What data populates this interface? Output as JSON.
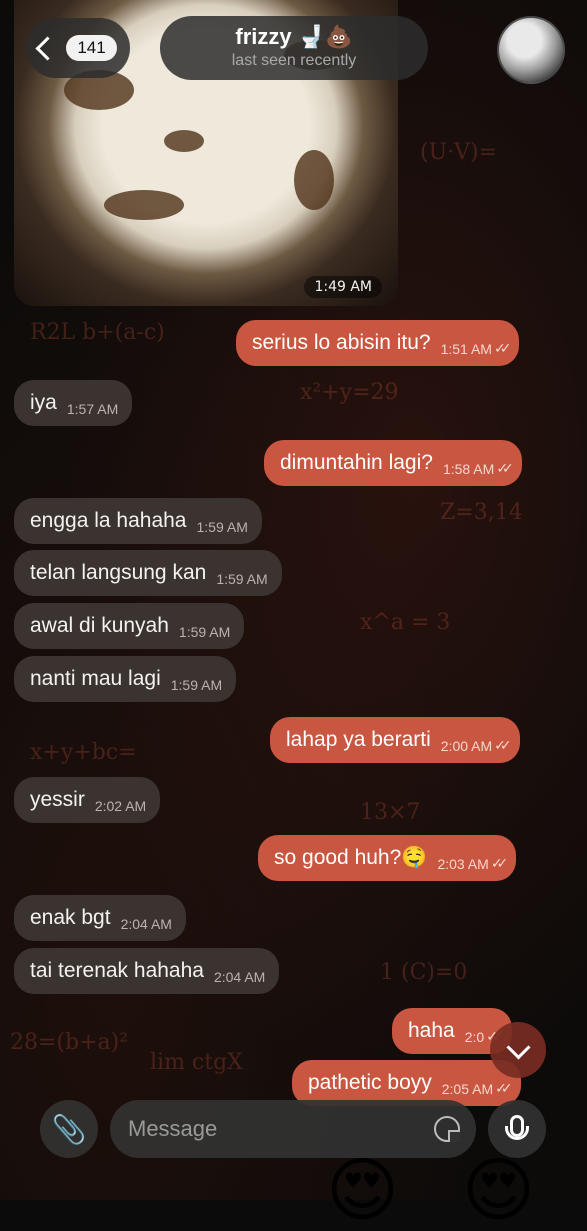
{
  "header": {
    "unread_count": "141",
    "contact_name": "frizzy 🚽💩",
    "status": "last seen recently"
  },
  "image_message": {
    "time": "1:49 AM"
  },
  "messages": [
    {
      "dir": "out",
      "text": "serius lo abisin itu?",
      "time": "1:51 AM",
      "ticks": "✓✓"
    },
    {
      "dir": "in",
      "text": "iya",
      "time": "1:57 AM"
    },
    {
      "dir": "out",
      "text": "dimuntahin lagi?",
      "time": "1:58 AM",
      "ticks": "✓✓"
    },
    {
      "dir": "in",
      "text": "engga la hahaha",
      "time": "1:59 AM"
    },
    {
      "dir": "in",
      "text": "telan langsung kan",
      "time": "1:59 AM"
    },
    {
      "dir": "in",
      "text": "awal di kunyah",
      "time": "1:59 AM"
    },
    {
      "dir": "in",
      "text": "nanti mau lagi",
      "time": "1:59 AM"
    },
    {
      "dir": "out",
      "text": "lahap ya berarti",
      "time": "2:00 AM",
      "ticks": "✓✓"
    },
    {
      "dir": "in",
      "text": "yessir",
      "time": "2:02 AM"
    },
    {
      "dir": "out",
      "text": "so good huh?🤤",
      "time": "2:03 AM",
      "ticks": "✓✓"
    },
    {
      "dir": "in",
      "text": "enak bgt",
      "time": "2:04 AM"
    },
    {
      "dir": "in",
      "text": "tai terenak hahaha",
      "time": "2:04 AM"
    },
    {
      "dir": "out",
      "text": "haha",
      "time": "2:0",
      "ticks": "✓✓"
    },
    {
      "dir": "out",
      "text": "pathetic boyy",
      "time": "2:05 AM",
      "ticks": "✓✓"
    }
  ],
  "composer": {
    "placeholder": "Message",
    "attach_icon": "paperclip-icon",
    "sticker_icon": "sticker-icon",
    "mic_icon": "microphone-icon"
  },
  "colors": {
    "outgoing_bubble": "#c95640",
    "incoming_bubble": "#3a3330",
    "background": "#0d0b0a"
  }
}
